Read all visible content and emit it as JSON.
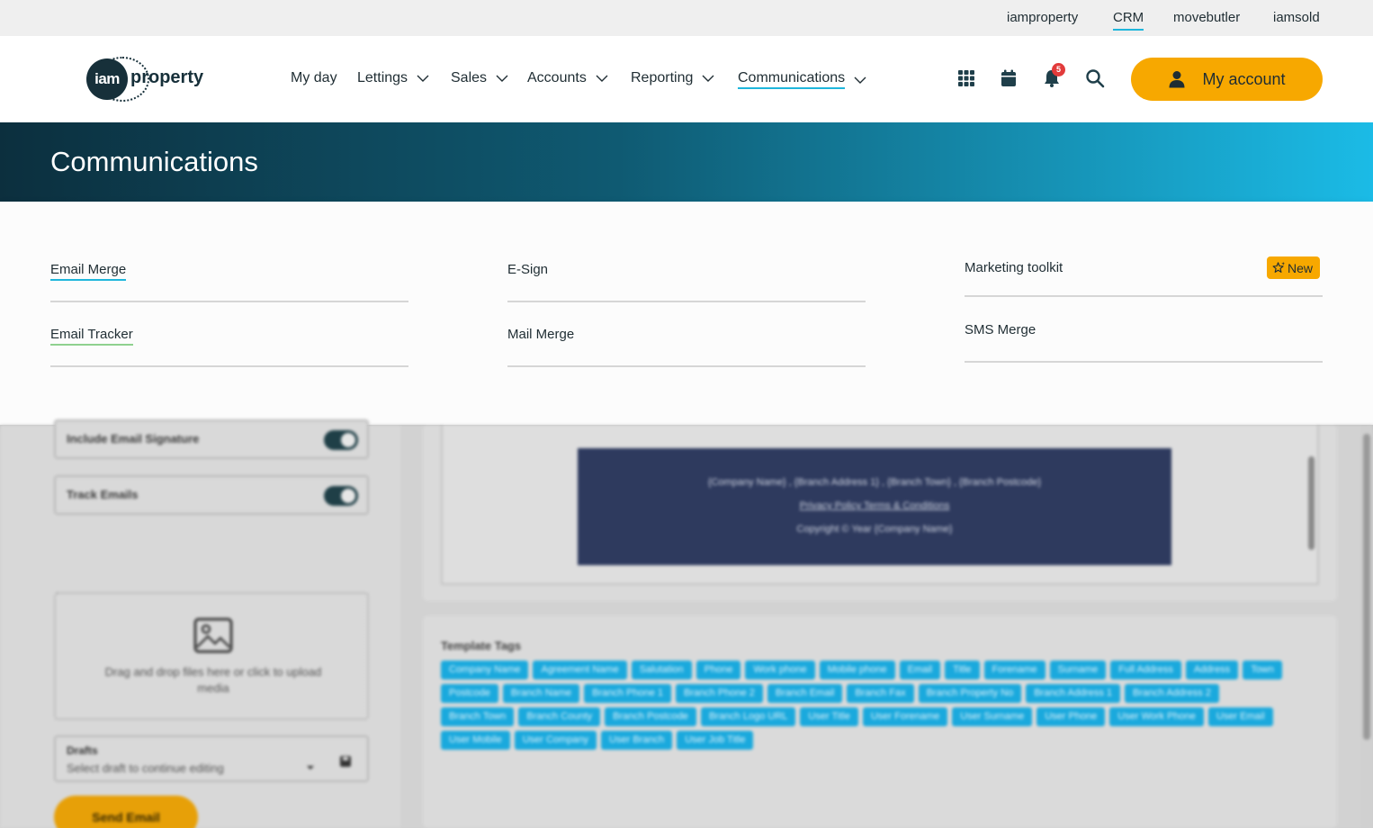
{
  "topbar": {
    "links": [
      "iamproperty",
      "CRM",
      "movebutler",
      "iamsold"
    ]
  },
  "logo": {
    "circle_text": "iam",
    "word": "property"
  },
  "nav": {
    "items": [
      {
        "label": "My day"
      },
      {
        "label": "Lettings"
      },
      {
        "label": "Sales"
      },
      {
        "label": "Accounts"
      },
      {
        "label": "Reporting"
      },
      {
        "label": "Communications"
      }
    ]
  },
  "header": {
    "icons": [
      "apps-grid-icon",
      "calendar-icon",
      "bell-icon",
      "search-icon"
    ],
    "notification_count": "5",
    "account_label": "My account"
  },
  "banner": {
    "title": "Communications"
  },
  "menu": {
    "col1": [
      "Email Merge",
      "Email Tracker"
    ],
    "col2": [
      "E-Sign",
      "Mail Merge"
    ],
    "col3": [
      "Marketing toolkit",
      "SMS Merge"
    ],
    "new_badge": "New"
  },
  "background": {
    "toggles": [
      "Include Email Signature",
      "Track Emails"
    ],
    "drop_zone": "Drag and drop files here or click to upload media",
    "drafts_label": "Drafts",
    "drafts_placeholder": "Select draft to continue editing",
    "send_label": "Send Email",
    "footer": {
      "address": "{Company Name} , {Branch Address 1} , {Branch Town} , {Branch Postcode}",
      "links": "Privacy Policy    Terms & Conditions",
      "copyright": "Copyright © Year {Company Name}"
    },
    "tags_title": "Template Tags",
    "tags": [
      "Company Name",
      "Agreement Name",
      "Salutation",
      "Phone",
      "Work phone",
      "Mobile phone",
      "Email",
      "Title",
      "Forename",
      "Surname",
      "Full Address",
      "Address",
      "Town",
      "Postcode",
      "Branch Name",
      "Branch Phone 1",
      "Branch Phone 2",
      "Branch Email",
      "Branch Fax",
      "Branch Property No",
      "Branch Address 1",
      "Branch Address 2",
      "Branch Town",
      "Branch County",
      "Branch Postcode",
      "Branch Logo URL",
      "User Title",
      "User Forename",
      "User Surname",
      "User Phone",
      "User Work Phone",
      "User Email",
      "User Mobile",
      "User Company",
      "User Branch",
      "User Job Title"
    ]
  }
}
